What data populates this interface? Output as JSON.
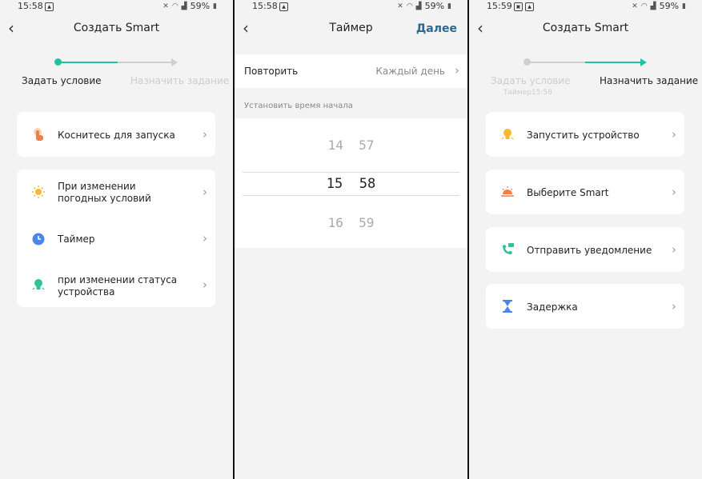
{
  "panel1": {
    "status": {
      "time": "15:58",
      "battery": "59%"
    },
    "title": "Создать Smart",
    "steps": [
      {
        "label": "Задать условие"
      },
      {
        "label": "Назначить задание"
      }
    ],
    "card1": [
      {
        "label": "Коснитесь для запуска",
        "icon": "hand-tap-icon"
      }
    ],
    "card2": [
      {
        "label": "При изменении погодных условий",
        "icon": "sun-icon"
      },
      {
        "label": "Таймер",
        "icon": "clock-icon"
      },
      {
        "label": "при изменении статуса устройства",
        "icon": "bulb-icon"
      }
    ]
  },
  "panel2": {
    "status": {
      "time": "15:58",
      "battery": "59%"
    },
    "title": "Таймер",
    "next": "Далее",
    "repeat": {
      "label": "Повторить",
      "value": "Каждый день"
    },
    "section": "Установить время начала",
    "picker": [
      {
        "h": "14",
        "m": "57"
      },
      {
        "h": "15",
        "m": "58"
      },
      {
        "h": "16",
        "m": "59"
      }
    ]
  },
  "panel3": {
    "status": {
      "time": "15:59",
      "battery": "59%"
    },
    "title": "Создать Smart",
    "steps": [
      {
        "label": "Задать условие",
        "sub": "Таймер15:58"
      },
      {
        "label": "Назначить задание"
      }
    ],
    "actions": [
      {
        "label": "Запустить устройство",
        "icon": "bulb-icon"
      },
      {
        "label": "Выберите Smart",
        "icon": "sunrise-icon"
      },
      {
        "label": "Отправить уведомление",
        "icon": "phone-message-icon"
      },
      {
        "label": "Задержка",
        "icon": "hourglass-icon"
      }
    ]
  },
  "colors": {
    "accent": "#1fc3a0",
    "inactive": "#cfcfcf",
    "link": "#2b6a8e",
    "background": "#f3f3f3"
  }
}
